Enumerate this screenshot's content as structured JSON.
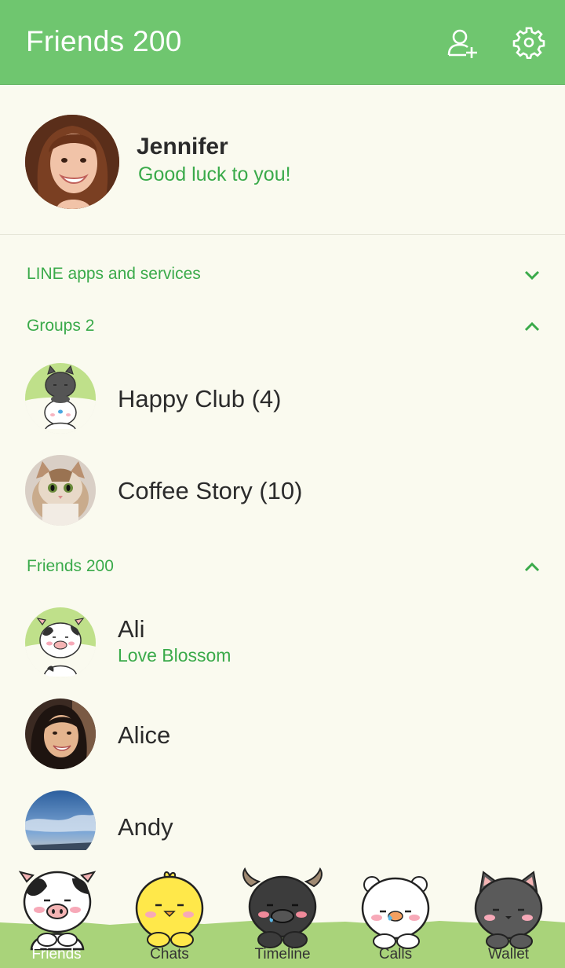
{
  "header": {
    "title": "Friends 200",
    "add_friend_icon": "add-friend-icon",
    "settings_icon": "gear-icon",
    "bg_color": "#6fc66f"
  },
  "profile": {
    "name": "Jennifer",
    "status": "Good luck to you!"
  },
  "sections": {
    "services": {
      "label": "LINE apps and services",
      "state": "collapsed"
    },
    "groups": {
      "label": "Groups 2",
      "state": "expanded"
    },
    "friends": {
      "label": "Friends 200",
      "state": "expanded"
    }
  },
  "groups": [
    {
      "name": "Happy Club (4)",
      "avatar": "cat-bear-sticker"
    },
    {
      "name": "Coffee Story (10)",
      "avatar": "cat-photo"
    }
  ],
  "friends": [
    {
      "name": "Ali",
      "status": "Love Blossom",
      "avatar": "cow-sticker"
    },
    {
      "name": "Alice",
      "status": "",
      "avatar": "woman-photo"
    },
    {
      "name": "Andy",
      "status": "",
      "avatar": "sky-photo"
    }
  ],
  "tabs": [
    {
      "label": "Friends",
      "icon": "cow-icon",
      "active": true
    },
    {
      "label": "Chats",
      "icon": "chick-icon",
      "active": false
    },
    {
      "label": "Timeline",
      "icon": "bull-icon",
      "active": false
    },
    {
      "label": "Calls",
      "icon": "bear-icon",
      "active": false
    },
    {
      "label": "Wallet",
      "icon": "cat-icon",
      "active": false
    }
  ],
  "colors": {
    "accent_green": "#3aaa4a",
    "background": "#fafaef",
    "grass": "#a9d37a"
  }
}
